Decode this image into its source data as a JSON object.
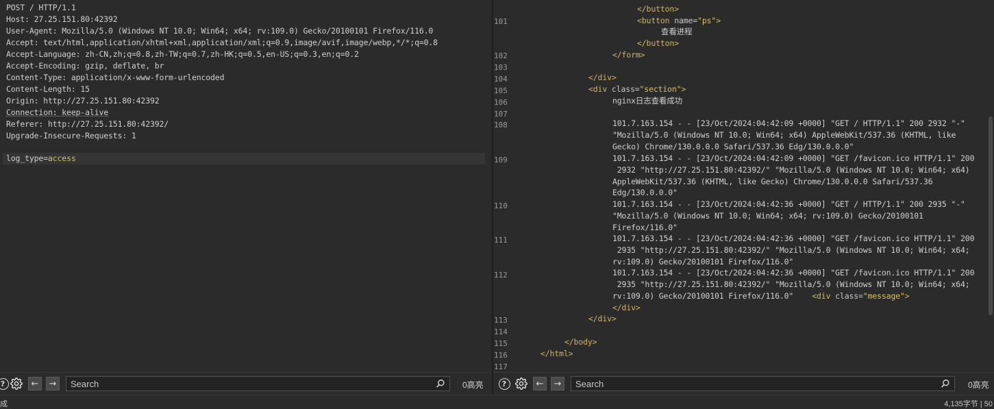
{
  "request": {
    "lines": [
      "POST / HTTP/1.1",
      "Host: 27.25.151.80:42392",
      "User-Agent: Mozilla/5.0 (Windows NT 10.0; Win64; x64; rv:109.0) Gecko/20100101 Firefox/116.0",
      "Accept: text/html,application/xhtml+xml,application/xml;q=0.9,image/avif,image/webp,*/*;q=0.8",
      "Accept-Language: zh-CN,zh;q=0.8,zh-TW;q=0.7,zh-HK;q=0.5,en-US;q=0.3,en;q=0.2",
      "Accept-Encoding: gzip, deflate, br",
      "Content-Type: application/x-www-form-urlencoded",
      "Content-Length: 15",
      "Origin: http://27.25.151.80:42392",
      "Connection: keep-alive",
      "Referer: http://27.25.151.80:42392/",
      "Upgrade-Insecure-Requests: 1",
      ""
    ],
    "body_key": "log_type",
    "body_eq": "=",
    "body_value": "access"
  },
  "response": {
    "line_numbers": [
      "101",
      "102",
      "103",
      "104",
      "105",
      "106",
      "107",
      "108",
      "109",
      "110",
      "111",
      "112",
      "113",
      "114",
      "115",
      "116",
      "117"
    ],
    "code": {
      "close_button_top": "</button>",
      "button_open": "<button",
      "button_attr": " name=",
      "button_attr_val": "\"ps\"",
      "button_close_bracket": ">",
      "view_process": "查看进程",
      "close_button": "</button>",
      "close_form": "</form>",
      "close_div_104": "</div>",
      "div_open": "<div",
      "div_attr": " class=",
      "div_attr_val": "\"section\"",
      "div_close_bracket": ">",
      "nginx_msg": "nginx日志查看成功",
      "log108a": "101.7.163.154 - - [23/Oct/2024:04:42:09 +0000] \"GET / HTTP/1.1\" 200 2932 \"-\"",
      "log108b": "\"Mozilla/5.0 (Windows NT 10.0; Win64; x64) AppleWebKit/537.36 (KHTML, like",
      "log108c": "Gecko) Chrome/130.0.0.0 Safari/537.36 Edg/130.0.0.0\"",
      "log109a": "101.7.163.154 - - [23/Oct/2024:04:42:09 +0000] \"GET /favicon.ico HTTP/1.1\" 200",
      "log109b": " 2932 \"http://27.25.151.80:42392/\" \"Mozilla/5.0 (Windows NT 10.0; Win64; x64)",
      "log109c": "AppleWebKit/537.36 (KHTML, like Gecko) Chrome/130.0.0.0 Safari/537.36",
      "log109d": "Edg/130.0.0.0\"",
      "log110a": "101.7.163.154 - - [23/Oct/2024:04:42:36 +0000] \"GET / HTTP/1.1\" 200 2935 \"-\"",
      "log110b": "\"Mozilla/5.0 (Windows NT 10.0; Win64; x64; rv:109.0) Gecko/20100101",
      "log110c": "Firefox/116.0\"",
      "log111a": "101.7.163.154 - - [23/Oct/2024:04:42:36 +0000] \"GET /favicon.ico HTTP/1.1\" 200",
      "log111b": " 2935 \"http://27.25.151.80:42392/\" \"Mozilla/5.0 (Windows NT 10.0; Win64; x64;",
      "log111c": "rv:109.0) Gecko/20100101 Firefox/116.0\"",
      "log112a": "101.7.163.154 - - [23/Oct/2024:04:42:36 +0000] \"GET /favicon.ico HTTP/1.1\" 200",
      "log112b": " 2935 \"http://27.25.151.80:42392/\" \"Mozilla/5.0 (Windows NT 10.0; Win64; x64;",
      "log112c_text": "rv:109.0) Gecko/20100101 Firefox/116.0\"    ",
      "log112c_tag": "<div",
      "log112c_attr": " class=",
      "log112c_val": "\"message\"",
      "log112c_close": ">",
      "close_div_112": "</div>",
      "close_div_113": "</div>",
      "close_body": "</body>",
      "close_html": "</html>"
    }
  },
  "toolbar": {
    "search_placeholder": "Search",
    "highlight_count": "0高亮",
    "icons": [
      "help-icon",
      "gear-icon",
      "arrow-left-icon",
      "arrow-right-icon",
      "search-icon"
    ]
  },
  "status": {
    "left": "成",
    "right": "4,135字节 | 50"
  },
  "colors": {
    "accent": "#e36b2d",
    "string": "#d9c167",
    "tag": "#d2b36a"
  }
}
